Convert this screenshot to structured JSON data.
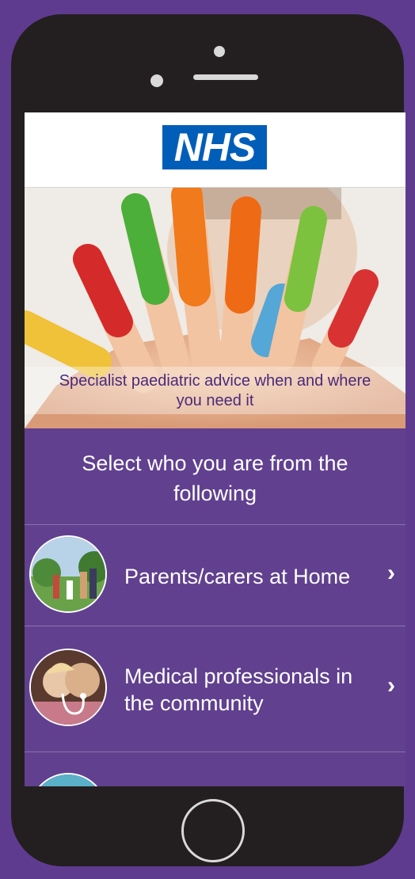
{
  "header": {
    "logo_text": "NHS"
  },
  "hero": {
    "caption_line1": "Specialist paediatric advice when and where",
    "caption_line2": "you need it"
  },
  "prompt": {
    "line1": "Select who you are from the",
    "line2": "following"
  },
  "options": [
    {
      "label": "Parents/carers at Home",
      "icon": "family-photo"
    },
    {
      "label_line1": "Medical professionals in",
      "label_line2": "the community",
      "icon": "stethoscope-photo"
    },
    {
      "label": "",
      "icon": "partial-photo"
    }
  ],
  "colors": {
    "brand_purple": "#61408f",
    "nhs_blue": "#005eb8"
  },
  "chevron": "›"
}
